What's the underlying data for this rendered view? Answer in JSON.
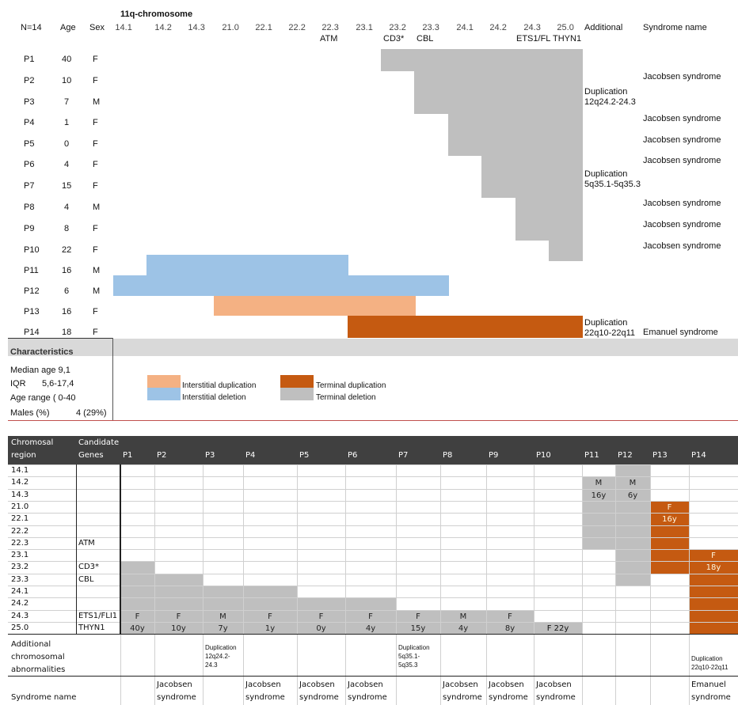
{
  "top": {
    "n_label": "N=14",
    "age_label": "Age",
    "sex_label": "Sex",
    "chrom_title": "11q-chromosome",
    "bands": [
      "14.1",
      "14.2",
      "14.3",
      "21.0",
      "22.1",
      "22.2",
      "22.3",
      "23.1",
      "23.2",
      "23.3",
      "24.1",
      "24.2",
      "24.3",
      "25.0"
    ],
    "genes_row": [
      "",
      "",
      "",
      "",
      "",
      "",
      "ATM",
      "",
      "CD3*",
      "CBL",
      "",
      "",
      "ETS1/FL",
      "THYN1"
    ],
    "additional_label": "Additional",
    "syndrome_label": "Syndrome name",
    "patients": [
      {
        "id": "P1",
        "age": "40",
        "sex": "F",
        "syndrome": ""
      },
      {
        "id": "P2",
        "age": "10",
        "sex": "F",
        "syndrome": "Jacobsen syndrome"
      },
      {
        "id": "P3",
        "age": "7",
        "sex": "M",
        "syndrome": ""
      },
      {
        "id": "P4",
        "age": "1",
        "sex": "F",
        "syndrome": "Jacobsen syndrome"
      },
      {
        "id": "P5",
        "age": "0",
        "sex": "F",
        "syndrome": "Jacobsen syndrome"
      },
      {
        "id": "P6",
        "age": "4",
        "sex": "F",
        "syndrome": "Jacobsen syndrome"
      },
      {
        "id": "P7",
        "age": "15",
        "sex": "F",
        "syndrome": ""
      },
      {
        "id": "P8",
        "age": "4",
        "sex": "M",
        "syndrome": "Jacobsen syndrome"
      },
      {
        "id": "P9",
        "age": "8",
        "sex": "F",
        "syndrome": "Jacobsen syndrome"
      },
      {
        "id": "P10",
        "age": "22",
        "sex": "F",
        "syndrome": "Jacobsen syndrome"
      },
      {
        "id": "P11",
        "age": "16",
        "sex": "M",
        "syndrome": ""
      },
      {
        "id": "P12",
        "age": "6",
        "sex": "M",
        "syndrome": ""
      },
      {
        "id": "P13",
        "age": "16",
        "sex": "F",
        "syndrome": ""
      },
      {
        "id": "P14",
        "age": "18",
        "sex": "F",
        "syndrome": "Emanuel syndrome"
      }
    ],
    "additional_notes": [
      {
        "line1": "Duplication",
        "line2": "12q24.2-24.3"
      },
      {
        "line1": "Duplication",
        "line2": "5q35.1-5q35.3"
      },
      {
        "line1": "Duplication",
        "line2": "22q10-22q11"
      }
    ],
    "characteristics_title": "Characteristics",
    "median_age": "Median age  9,1",
    "iqr_label": "IQR",
    "iqr_value": "5,6-17,4",
    "age_range": "Age range (  0-40",
    "males_label": "Males (%)",
    "males_value": "4 (29%)",
    "legend": {
      "interstitial_dup": "Interstitial duplication",
      "interstitial_del": "Interstitial deletion",
      "terminal_dup": "Terminal duplication",
      "terminal_del": "Terminal deletion"
    },
    "colors": {
      "grey": "#bfbfbf",
      "blue": "#9dc3e6",
      "peach": "#f4b183",
      "orange": "#c55a11"
    }
  },
  "bottom": {
    "hdr_region_1": "Chromosal",
    "hdr_region_2": "region",
    "hdr_genes_1": "Candidate",
    "hdr_genes_2": "Genes",
    "patients": [
      "P1",
      "P2",
      "P3",
      "P4",
      "P5",
      "P6",
      "P7",
      "P8",
      "P9",
      "P10",
      "P11",
      "P12",
      "P13",
      "P14"
    ],
    "regions": [
      "14.1",
      "14.2",
      "14.3",
      "21.0",
      "22.1",
      "22.2",
      "22.3",
      "23.1",
      "23.2",
      "23.3",
      "24.1",
      "24.2",
      "24.3",
      "25.0"
    ],
    "genes": [
      "",
      "",
      "",
      "",
      "",
      "",
      "ATM",
      "",
      "CD3*",
      "CBL",
      "",
      "",
      "ETS1/FLI1",
      "THYN1"
    ],
    "sexes": [
      "F",
      "F",
      "M",
      "F",
      "F",
      "F",
      "F",
      "M",
      "F",
      "F",
      "M",
      "M",
      "F",
      "F"
    ],
    "ages": [
      "40y",
      "10y",
      "7y",
      "1y",
      "0y",
      "4y",
      "15y",
      "4y",
      "8y",
      "22y",
      "16y",
      "6y",
      "16y",
      "18y"
    ],
    "additional_label_1": "Additional",
    "additional_label_2": "chromosomal",
    "additional_label_3": "abnormalities",
    "add_p3": [
      "Duplication",
      "12q24.2-",
      "24.3"
    ],
    "add_p7": [
      "Duplication",
      "5q35.1-",
      "5q35.3"
    ],
    "add_p14": [
      "Duplication",
      "22q10-22q11"
    ],
    "syndrome_label": "Syndrome name",
    "syn_word1": "Jacobsen",
    "syn_word2": "syndrome",
    "syn_emanuel1": "Emanuel",
    "syn_emanuel2": "syndrome",
    "colors": {
      "grey": "#bfbfbf",
      "orange": "#c55a11",
      "header": "#404040"
    }
  }
}
